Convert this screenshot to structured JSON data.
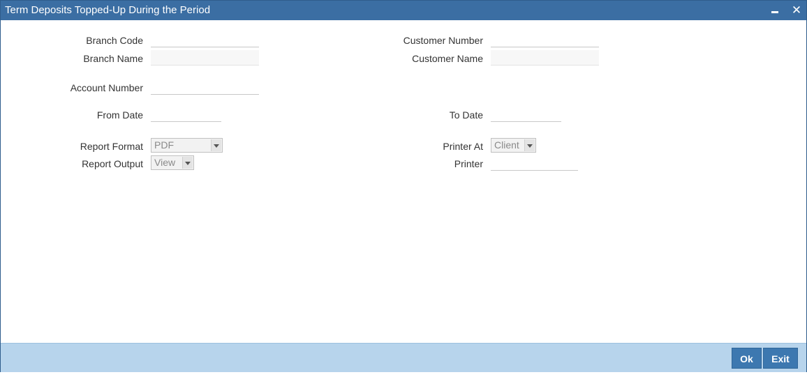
{
  "window": {
    "title": "Term Deposits Topped-Up During the Period",
    "minimize_icon": "minimize-icon",
    "close_icon": "close-icon",
    "close_glyph": "✕"
  },
  "form": {
    "branch_code": {
      "label": "Branch Code",
      "value": ""
    },
    "branch_name": {
      "label": "Branch Name",
      "value": ""
    },
    "customer_number": {
      "label": "Customer Number",
      "value": ""
    },
    "customer_name": {
      "label": "Customer Name",
      "value": ""
    },
    "account_number": {
      "label": "Account Number",
      "value": ""
    },
    "from_date": {
      "label": "From Date",
      "value": ""
    },
    "to_date": {
      "label": "To Date",
      "value": ""
    },
    "report_format": {
      "label": "Report Format",
      "value": "PDF"
    },
    "report_output": {
      "label": "Report Output",
      "value": "View"
    },
    "printer_at": {
      "label": "Printer At",
      "value": "Client"
    },
    "printer": {
      "label": "Printer",
      "value": ""
    }
  },
  "footer": {
    "ok_label": "Ok",
    "exit_label": "Exit"
  },
  "colors": {
    "titlebar": "#3b6ea3",
    "footer": "#b7d4ec",
    "button": "#3d78b0"
  }
}
